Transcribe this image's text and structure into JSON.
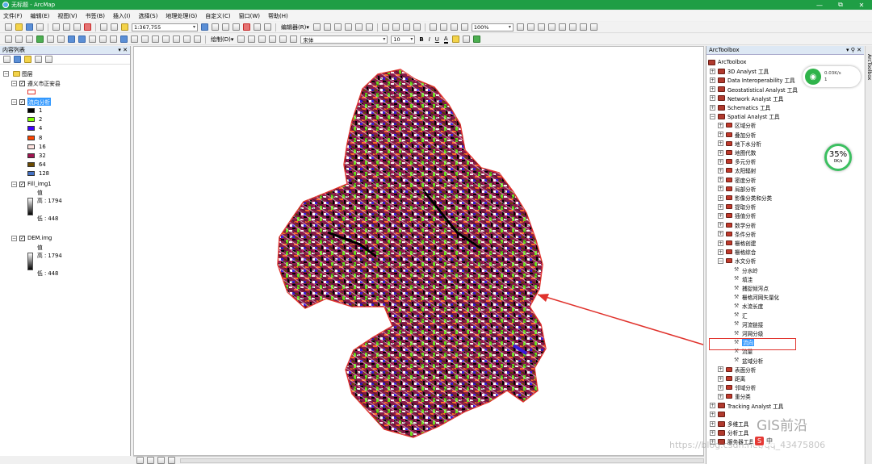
{
  "window": {
    "title": "无标题 - ArcMap",
    "controls": [
      "—",
      "⧉",
      "✕"
    ]
  },
  "menu": [
    "文件(F)",
    "编辑(E)",
    "视图(V)",
    "书签(B)",
    "插入(I)",
    "选择(S)",
    "地理处理(G)",
    "自定义(C)",
    "窗口(W)",
    "帮助(H)"
  ],
  "toolbar": {
    "scale": "1:367,755",
    "editor": "编辑器(R)▾",
    "zoom_pct": "100%",
    "draw": "绘制(D)▾",
    "font": "宋体",
    "font_size": "10",
    "bold": "B",
    "italic": "I",
    "underline": "U",
    "font_color": "A"
  },
  "toc": {
    "title": "内容列表",
    "root": "图层",
    "layers": [
      {
        "name": "遵义市正安县"
      },
      {
        "name": "流向分析",
        "legend": [
          "1",
          "2",
          "4",
          "8",
          "16",
          "32",
          "64",
          "128"
        ]
      },
      {
        "name": "Fill_img1",
        "value_label": "值",
        "high": "高 : 1794",
        "low": "低 : 448"
      },
      {
        "name": "DEM.img",
        "value_label": "值",
        "high": "高 : 1794",
        "low": "低 : 448"
      }
    ]
  },
  "legend_colors": [
    "#000000",
    "#7fff00",
    "#3f00ff",
    "#ff4500",
    "#ffe4e1",
    "#a01450",
    "#6b4a00",
    "#4472c4"
  ],
  "arctoolbox": {
    "title": "ArcToolbox",
    "root": "ArcToolbox",
    "top_items": [
      "3D Analyst 工具",
      "Data Interoperability 工具",
      "Geostatistical Analyst 工具",
      "Network Analyst 工具",
      "Schematics 工具",
      "Spatial Analyst 工具"
    ],
    "spatial_items": [
      "区域分析",
      "叠加分析",
      "地下水分析",
      "地图代数",
      "多元分析",
      "太阳辐射",
      "密度分析",
      "局部分析",
      "影像分类和分类",
      "提取分析",
      "插值分析",
      "数学分析",
      "条件分析",
      "栅格创建",
      "栅格综合",
      "水文分析"
    ],
    "hydro_items": [
      "分水岭",
      "填洼",
      "捕捉倾泻点",
      "栅格河网矢量化",
      "水流长度",
      "汇",
      "河流链接",
      "河网分级",
      "流向",
      "流量",
      "盆域分析"
    ],
    "after_items": [
      "表面分析",
      "距离",
      "邻域分析",
      "重分类"
    ],
    "bottom_items": [
      "Tracking Analyst 工具",
      "",
      "多维工具",
      "分析工具",
      "服务器工具"
    ]
  },
  "side_tab": "ArcToolbox",
  "net_widget": {
    "up": "0.03K/s",
    "down": "1"
  },
  "cpu_gauge": {
    "percent": "35%",
    "speed": "0K/s"
  },
  "watermark": {
    "brand": "GIS前沿",
    "url": "https://blog.csdn.net/qq_43475806",
    "ime": "中"
  }
}
